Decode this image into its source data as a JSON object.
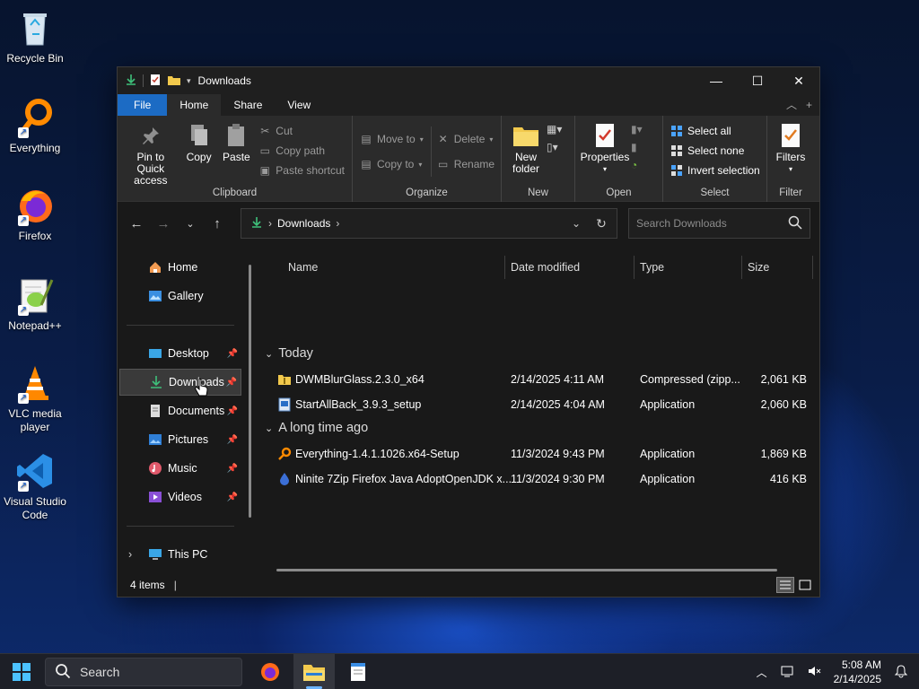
{
  "desktop": {
    "icons": [
      {
        "label": "Recycle Bin"
      },
      {
        "label": "Everything"
      },
      {
        "label": "Firefox"
      },
      {
        "label": "Notepad++"
      },
      {
        "label": "VLC media player"
      },
      {
        "label": "Visual Studio Code"
      }
    ]
  },
  "window": {
    "title": "Downloads",
    "tabs": {
      "file": "File",
      "home": "Home",
      "share": "Share",
      "view": "View"
    },
    "ribbon": {
      "clipboard": {
        "name": "Clipboard",
        "pin": "Pin to Quick access",
        "copy": "Copy",
        "paste": "Paste",
        "cut": "Cut",
        "copy_path": "Copy path",
        "paste_shortcut": "Paste shortcut"
      },
      "organize": {
        "name": "Organize",
        "move_to": "Move to",
        "copy_to": "Copy to",
        "delete": "Delete",
        "rename": "Rename"
      },
      "new": {
        "name": "New",
        "new_folder": "New folder"
      },
      "open": {
        "name": "Open",
        "properties": "Properties"
      },
      "select": {
        "name": "Select",
        "select_all": "Select all",
        "select_none": "Select none",
        "invert": "Invert selection"
      },
      "filter": {
        "name": "Filter",
        "filters": "Filters"
      }
    },
    "address": {
      "path": "Downloads"
    },
    "search": {
      "placeholder": "Search Downloads"
    },
    "nav": {
      "home": "Home",
      "gallery": "Gallery",
      "desktop": "Desktop",
      "downloads": "Downloads",
      "documents": "Documents",
      "pictures": "Pictures",
      "music": "Music",
      "videos": "Videos",
      "this_pc": "This PC"
    },
    "columns": {
      "name": "Name",
      "date": "Date modified",
      "type": "Type",
      "size": "Size"
    },
    "groups": [
      {
        "label": "Today",
        "files": [
          {
            "name": "DWMBlurGlass.2.3.0_x64",
            "date": "2/14/2025 4:11 AM",
            "type": "Compressed (zipp...",
            "size": "2,061 KB"
          },
          {
            "name": "StartAllBack_3.9.3_setup",
            "date": "2/14/2025 4:04 AM",
            "type": "Application",
            "size": "2,060 KB"
          }
        ]
      },
      {
        "label": "A long time ago",
        "files": [
          {
            "name": "Everything-1.4.1.1026.x64-Setup",
            "date": "11/3/2024 9:43 PM",
            "type": "Application",
            "size": "1,869 KB"
          },
          {
            "name": "Ninite 7Zip Firefox Java AdoptOpenJDK x...",
            "date": "11/3/2024 9:30 PM",
            "type": "Application",
            "size": "416 KB"
          }
        ]
      }
    ],
    "status": {
      "items": "4 items"
    }
  },
  "taskbar": {
    "search": "Search",
    "time": "5:08 AM",
    "date": "2/14/2025"
  },
  "colors": {
    "accent": "#1c6bc4",
    "window_bg": "#191919",
    "ribbon_bg": "#2b2b2b",
    "taskbar_bg": "#1d1f27"
  }
}
